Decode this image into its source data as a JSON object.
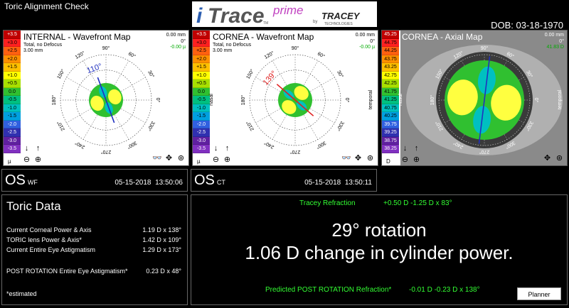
{
  "window_title": "Toric Alignment Check",
  "dob": "DOB: 03-18-1970",
  "logo": {
    "i": "i",
    "trace": "Trace",
    "prime": "prime",
    "tm": "TM",
    "by": "by",
    "brand": "TRACEY",
    "brand_sub": "TECHNOLOGIES"
  },
  "scale_um": [
    "+3.5",
    "+3.0",
    "+2.5",
    "+2.0",
    "+1.5",
    "+1.0",
    "+0.5",
    "0.0",
    "-0.5",
    "-1.0",
    "-1.5",
    "-2.0",
    "-2.5",
    "-3.0",
    "-3.5"
  ],
  "scale_d": [
    "45.25",
    "44.75",
    "44.25",
    "43.75",
    "43.25",
    "42.75",
    "42.25",
    "41.75",
    "41.25",
    "40.75",
    "40.25",
    "39.75",
    "39.25",
    "38.75",
    "38.25"
  ],
  "scale_colors": [
    "#c00000",
    "#ff2020",
    "#ff6010",
    "#ff9000",
    "#ffc000",
    "#ffff00",
    "#a8e000",
    "#30c030",
    "#00c080",
    "#00c0c0",
    "#00a0e0",
    "#3060e0",
    "#3030b0",
    "#6020a0",
    "#8030c0"
  ],
  "panels": [
    {
      "title": "INTERNAL - Wavefront Map",
      "sub1": "Total, no Defocus",
      "sub2": "3.00 mm",
      "mm": "0.00 mm",
      "deg": "0°",
      "val": "-0.00 µ",
      "unit": "µ",
      "axis_label": "110°",
      "axis_color": "#2030c0",
      "side_left": "",
      "side_right": ""
    },
    {
      "title": "CORNEA - Wavefront Map",
      "sub1": "Total, no Defocus",
      "sub2": "3.00 mm",
      "mm": "0.00 mm",
      "deg": "0°",
      "val": "-0.00 µ",
      "unit": "µ",
      "axis_label": "139°",
      "axis_color": "#e02020",
      "side_left": "nasal",
      "side_right": "temporal"
    },
    {
      "title": "CORNEA - Axial Map",
      "sub1": "",
      "sub2": "",
      "mm": "0.00 mm",
      "deg": "0°",
      "val": "41.83 D",
      "unit": "D",
      "axis_label": "90°",
      "axis_color": "#2030c0",
      "side_left": "nasal",
      "side_right": "temporal"
    }
  ],
  "angle_labels": [
    "0°",
    "30°",
    "60°",
    "90°",
    "120°",
    "150°",
    "180°",
    "210°",
    "240°",
    "270°",
    "300°",
    "330°"
  ],
  "exams": [
    {
      "eye": "OS",
      "type": "WF",
      "date": "05-15-2018",
      "time": "13:50:06"
    },
    {
      "eye": "OS",
      "type": "CT",
      "date": "05-15-2018",
      "time": "13:50:11"
    }
  ],
  "toric": {
    "heading": "Toric Data",
    "rows": [
      {
        "label": "Current Corneal Power & Axis",
        "value": "1.19 D x 138°"
      },
      {
        "label": "TORIC lens Power & Axis*",
        "value": "1.42 D x 109°"
      },
      {
        "label": "Current Entire Eye Astigmatism",
        "value": "1.29 D x 173°"
      },
      {
        "label": "POST ROTATION Entire Eye Astigmatism*",
        "value": "0.23 D x 48°"
      }
    ],
    "note": "*estimated"
  },
  "result": {
    "refraction_label": "Tracey Refraction",
    "refraction_value": "+0.50 D -1.25 D x 83°",
    "rotation": "29° rotation",
    "cyl_change": "1.06 D change in cylinder power.",
    "predicted_label": "Predicted POST ROTATION Refraction*",
    "predicted_value": "-0.01 D  -0.23 D x 138°",
    "planner_label": "Planner"
  }
}
